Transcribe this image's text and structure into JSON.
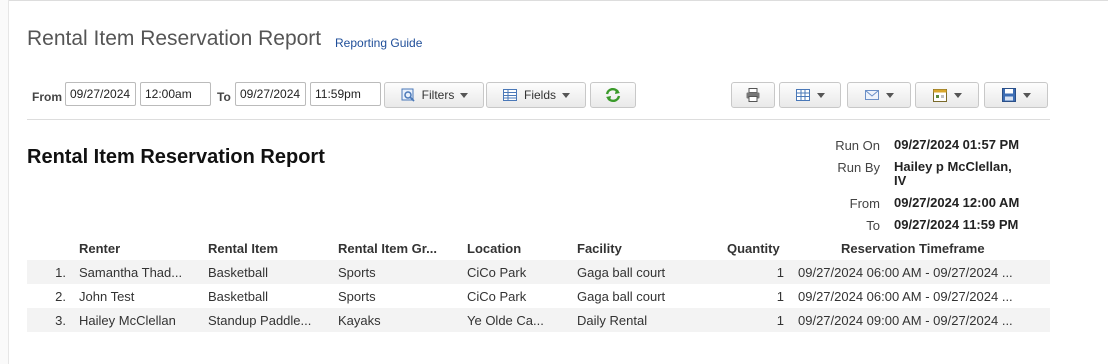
{
  "page": {
    "title": "Rental Item Reservation Report",
    "guide_link": "Reporting Guide"
  },
  "toolbar": {
    "from_label": "From",
    "from_date": "09/27/2024",
    "from_time": "12:00am",
    "to_label": "To",
    "to_date": "09/27/2024",
    "to_time": "11:59pm",
    "filters_label": "Filters",
    "fields_label": "Fields",
    "icons": [
      "refresh-icon",
      "print-icon",
      "grid-view-icon",
      "email-icon",
      "calendar-icon",
      "save-icon"
    ]
  },
  "report": {
    "title": "Rental Item Reservation Report",
    "meta": {
      "run_on_label": "Run On",
      "run_on_value": "09/27/2024 01:57 PM",
      "run_by_label": "Run By",
      "run_by_value_line1": "Hailey p McClellan,",
      "run_by_value_line2": "IV",
      "from_label": "From",
      "from_value": "09/27/2024 12:00 AM",
      "to_label": "To",
      "to_value": "09/27/2024 11:59 PM"
    },
    "columns": [
      "Renter",
      "Rental Item",
      "Rental Item Gr...",
      "Location",
      "Facility",
      "Quantity",
      "Reservation Timeframe"
    ],
    "rows": [
      {
        "num": "1.",
        "renter": "Samantha Thad...",
        "item": "Basketball",
        "group": "Sports",
        "location": "CiCo Park",
        "facility": "Gaga ball court",
        "qty": "1",
        "timeframe": "09/27/2024 06:00 AM - 09/27/2024 ..."
      },
      {
        "num": "2.",
        "renter": "John Test",
        "item": "Basketball",
        "group": "Sports",
        "location": "CiCo Park",
        "facility": "Gaga ball court",
        "qty": "1",
        "timeframe": "09/27/2024 06:00 AM - 09/27/2024 ..."
      },
      {
        "num": "3.",
        "renter": "Hailey McClellan",
        "item": "Standup Paddle...",
        "group": "Kayaks",
        "location": "Ye Olde Ca...",
        "facility": "Daily Rental",
        "qty": "1",
        "timeframe": "09/27/2024 09:00 AM - 09/27/2024 ..."
      }
    ]
  },
  "colors": {
    "link": "#1f4e99",
    "row_shade": "#f3f3f3",
    "refresh_green": "#3a9a2a"
  }
}
